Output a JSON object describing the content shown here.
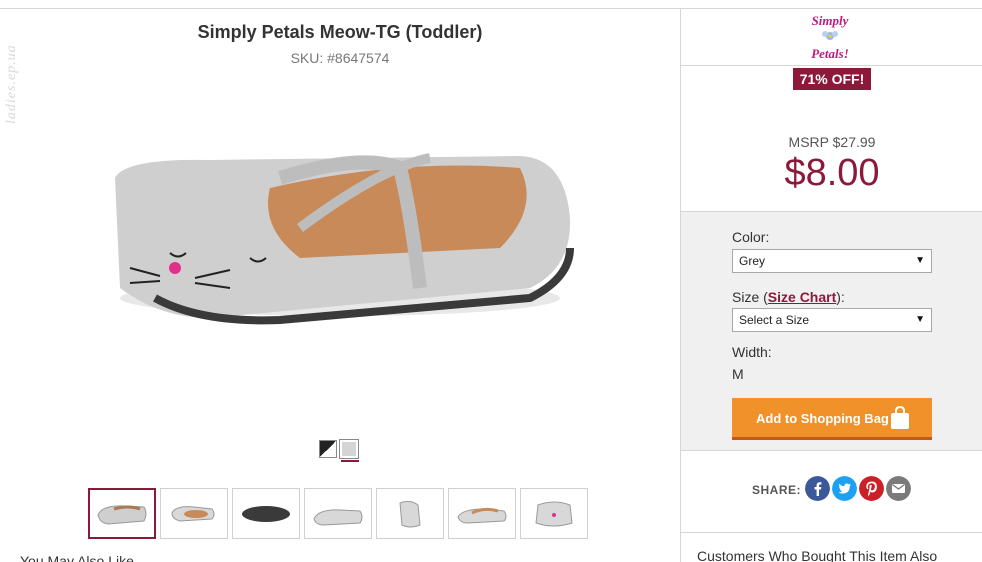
{
  "watermark": "ladies.ep.ua",
  "product": {
    "title": "Simply Petals Meow-TG (Toddler)",
    "sku": "SKU: #8647574",
    "main_image": "grey-cat-ballet-flat-shoe",
    "swatches": [
      {
        "name": "black-white",
        "selected": false
      },
      {
        "name": "grey",
        "selected": true
      }
    ],
    "thumbnails": [
      {
        "name": "shoe-top-view",
        "selected": true
      },
      {
        "name": "shoe-pair-top-view",
        "selected": false
      },
      {
        "name": "shoe-sole-view",
        "selected": false
      },
      {
        "name": "shoe-side-view",
        "selected": false
      },
      {
        "name": "shoe-back-view",
        "selected": false
      },
      {
        "name": "shoe-inner-side-view",
        "selected": false
      },
      {
        "name": "shoe-front-view",
        "selected": false
      }
    ],
    "also_like": "You May Also Like"
  },
  "sidebar": {
    "brand_logo_text": "Simply Petals!",
    "discount_badge": "71% OFF!",
    "msrp": "MSRP $27.99",
    "price": "$8.00",
    "color": {
      "label": "Color:",
      "selected": "Grey"
    },
    "size": {
      "label_prefix": "Size (",
      "chart_link": "Size Chart",
      "label_suffix": "):",
      "selected": "Select a Size"
    },
    "width": {
      "label": "Width:",
      "value": "M"
    },
    "add_to_bag": "Add to Shopping Bag",
    "share": {
      "label": "SHARE:",
      "icons": [
        "facebook-icon",
        "twitter-icon",
        "pinterest-icon",
        "email-icon"
      ]
    },
    "customers_also": "Customers Who Bought This Item Also"
  },
  "colors": {
    "accent": "#8b1a3a",
    "button": "#f0912a",
    "facebook": "#3b5998",
    "twitter": "#1da1f2",
    "pinterest": "#cb2027",
    "email": "#7a7a7a"
  }
}
